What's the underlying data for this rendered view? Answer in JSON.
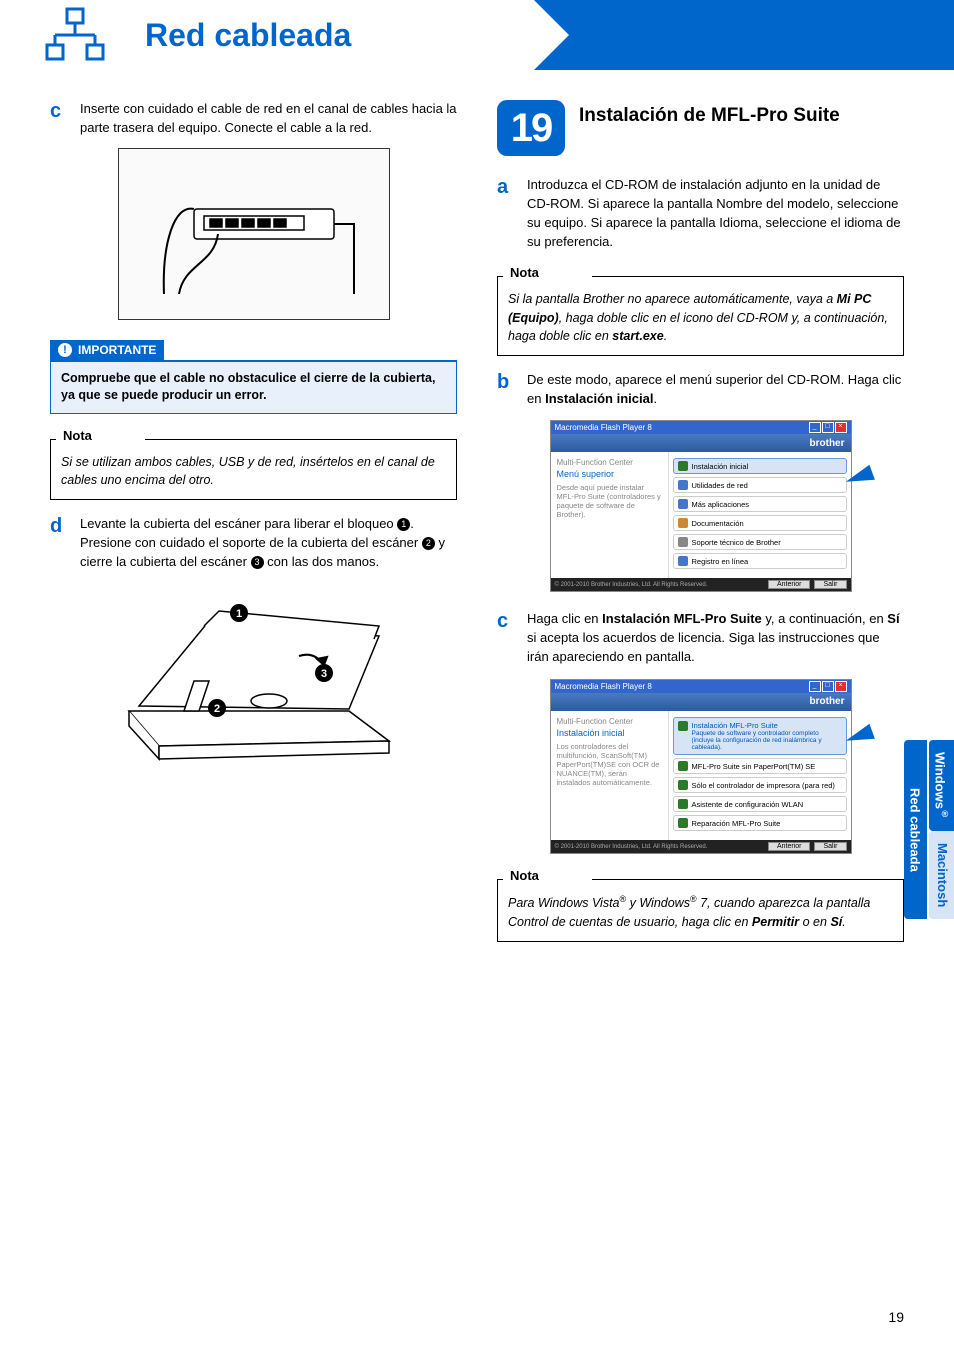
{
  "header": {
    "left_title": "Red cableada",
    "right_title": "Windows",
    "right_sup": "®"
  },
  "left_column": {
    "step_c": {
      "letter": "c",
      "text": "Inserte con cuidado el cable de red en el canal de cables hacia la parte trasera del equipo. Conecte el cable a la red."
    },
    "importante": {
      "title": "IMPORTANTE",
      "body": "Compruebe que el cable no obstaculice el cierre de la cubierta, ya que se puede producir un error."
    },
    "nota1": {
      "title": "Nota",
      "body": "Si se utilizan ambos cables, USB y de red, insértelos en el canal de cables uno encima del otro."
    },
    "step_d": {
      "letter": "d",
      "line1_a": "Levante la cubierta del escáner para liberar el bloqueo ",
      "line1_b": ".",
      "line2_a": "Presione con cuidado el soporte de la cubierta del escáner ",
      "line2_b": " y cierre la cubierta del escáner ",
      "line2_c": " con las dos manos."
    }
  },
  "right_column": {
    "big_step": {
      "number": "19",
      "title": "Instalación de MFL-Pro Suite"
    },
    "step_a": {
      "letter": "a",
      "text": "Introduzca el CD-ROM de instalación adjunto en la unidad de CD-ROM. Si aparece la pantalla Nombre del modelo, seleccione su equipo. Si aparece la pantalla Idioma, seleccione el idioma de su preferencia."
    },
    "nota2": {
      "title": "Nota",
      "body_a": "Si la pantalla Brother no aparece automáticamente, vaya a ",
      "body_b": "Mi PC (Equipo)",
      "body_c": ", haga doble clic en el icono del CD-ROM y, a continuación, haga doble clic en ",
      "body_d": "start.exe",
      "body_e": "."
    },
    "step_b": {
      "letter": "b",
      "text_a": "De este modo, aparece el menú superior del CD-ROM. Haga clic en ",
      "text_b": "Instalación inicial",
      "text_c": "."
    },
    "screenshot1": {
      "titlebar": "Macromedia Flash Player 8",
      "brand": "brother",
      "mfc": "Multi-Function Center",
      "menu_title": "Menú superior",
      "side_desc": "Desde aquí puede instalar MFL-Pro Suite (controladores y paquete de software de Brother).",
      "items": [
        "Instalación inicial",
        "Utilidades de red",
        "Más aplicaciones",
        "Documentación",
        "Soporte técnico de Brother",
        "Registro en línea"
      ],
      "footer_copy": "© 2001-2010 Brother Industries, Ltd. All Rights Reserved.",
      "btn_prev": "Anterior",
      "btn_exit": "Salir"
    },
    "step_c2": {
      "letter": "c",
      "text_a": "Haga clic en ",
      "text_b": "Instalación MFL-Pro Suite",
      "text_c": " y, a continuación, en ",
      "text_d": "Sí",
      "text_e": " si acepta los acuerdos de licencia. Siga las instrucciones que irán apareciendo en pantalla."
    },
    "screenshot2": {
      "titlebar": "Macromedia Flash Player 8",
      "brand": "brother",
      "mfc": "Multi-Function Center",
      "menu_title": "Instalación inicial",
      "side_desc": "Los controladores del multifunción, ScanSoft(TM) PaperPort(TM)SE con OCR de NUANCE(TM), serán instalados automáticamente.",
      "item_main_title": "Instalación MFL-Pro Suite",
      "item_main_desc": "Paquete de software y controlador completo (incluye la configuración de red inalámbrica y cableada).",
      "items_rest": [
        "MFL-Pro Suite sin PaperPort(TM) SE",
        "Sólo el controlador de impresora (para red)",
        "Asistente de configuración WLAN",
        "Reparación MFL-Pro Suite"
      ],
      "footer_copy": "© 2001-2010 Brother Industries, Ltd. All Rights Reserved.",
      "btn_prev": "Anterior",
      "btn_exit": "Salir"
    },
    "nota3": {
      "title": "Nota",
      "body_a": "Para Windows Vista",
      "body_b": " y Windows",
      "body_c": " 7, cuando aparezca la pantalla Control de cuentas de usuario, haga clic en ",
      "body_d": "Permitir",
      "body_e": " o en ",
      "body_f": "Sí",
      "body_g": "."
    }
  },
  "side_tabs": {
    "windows": "Windows",
    "macintosh": "Macintosh",
    "red": "Red cableada",
    "reg": "®"
  },
  "page_number": "19"
}
